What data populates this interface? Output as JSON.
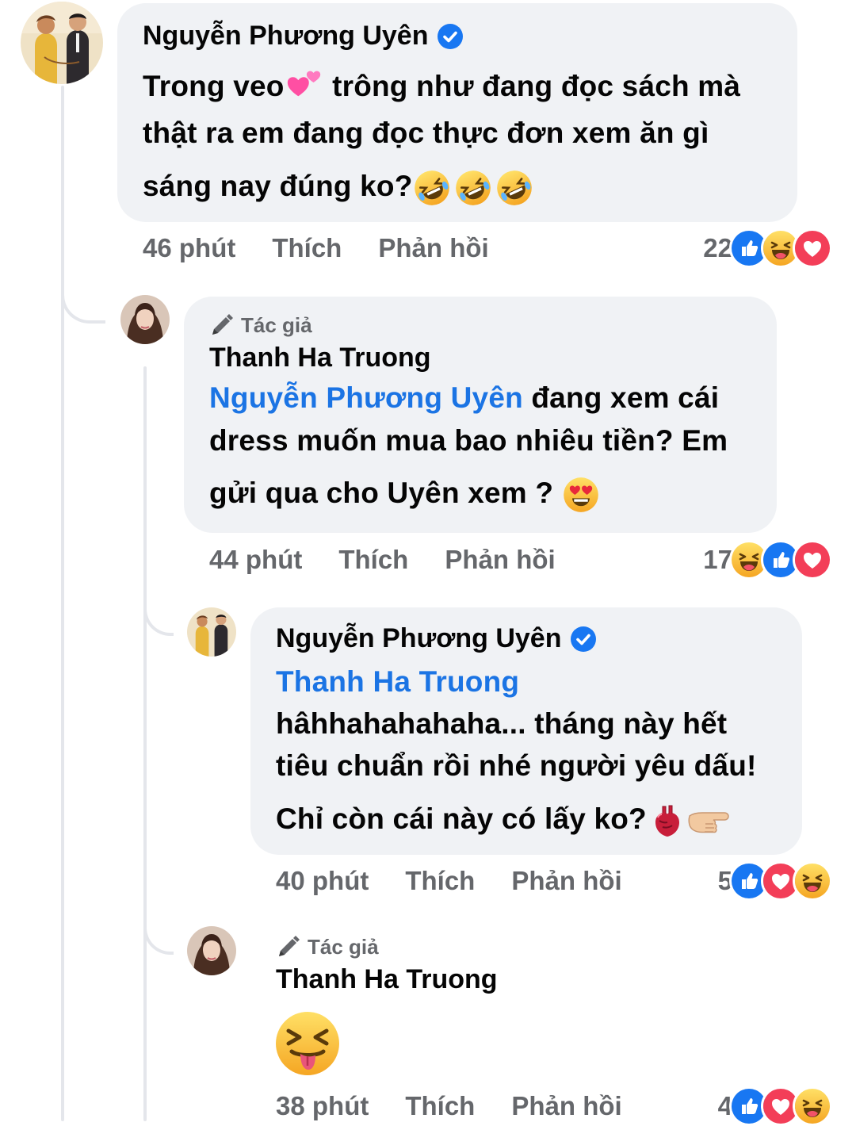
{
  "colors": {
    "bubble": "#f0f2f5",
    "mention": "#1b74e4",
    "like_blue": "#1877f2",
    "love_red": "#f33e58",
    "haha_yellow": "#f7b928"
  },
  "comments": [
    {
      "author": "Nguyễn Phương Uyên",
      "verified": true,
      "text_1": "Trong veo",
      "text_2": " trông như đang đọc sách mà",
      "text_3": "thật ra em đang đọc thực đơn xem ăn gì",
      "text_4": "sáng nay đúng ko?",
      "time": "46 phút",
      "like": "Thích",
      "reply": "Phản hồi",
      "reaction_count": "22",
      "reaction_icons": [
        "like-icon",
        "haha-icon",
        "love-icon"
      ]
    },
    {
      "author_tag": "Tác giả",
      "author": "Thanh Ha Truong",
      "mention": "Nguyễn Phương Uyên",
      "text_1": " đang xem cái",
      "text_2": "dress muốn mua bao nhiêu tiền? Em",
      "text_3": "gửi qua cho Uyên xem ? ",
      "time": "44 phút",
      "like": "Thích",
      "reply": "Phản hồi",
      "reaction_count": "17",
      "reaction_icons": [
        "haha-icon",
        "like-icon",
        "love-icon"
      ]
    },
    {
      "author": "Nguyễn Phương Uyên",
      "verified": true,
      "mention": "Thanh Ha Truong",
      "text_1": "hâhhahahahaha... tháng này hết",
      "text_2": "tiêu chuẩn rồi nhé người yêu dấu!",
      "text_3": "Chỉ còn cái này có lấy ko?",
      "time": "40 phút",
      "like": "Thích",
      "reply": "Phản hồi",
      "reaction_count": "5",
      "reaction_icons": [
        "like-icon",
        "love-icon",
        "haha-icon"
      ]
    },
    {
      "author_tag": "Tác giả",
      "author": "Thanh Ha Truong",
      "time": "38 phút",
      "like": "Thích",
      "reply": "Phản hồi",
      "reaction_count": "4",
      "reaction_icons": [
        "like-icon",
        "love-icon",
        "haha-icon"
      ]
    }
  ]
}
